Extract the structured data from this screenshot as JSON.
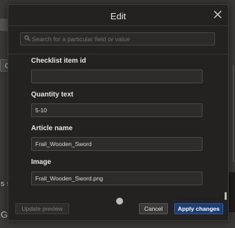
{
  "background": {
    "button_fragment": "C",
    "text_fragment_1": "s sl",
    "text_fragment_2": "Gr"
  },
  "modal": {
    "title": "Edit",
    "close_icon": "close-icon",
    "search": {
      "placeholder": "Search for a particular field or value",
      "icon": "search-icon"
    },
    "fields": [
      {
        "label": "Checklist item id",
        "value": ""
      },
      {
        "label": "Quantity text",
        "value": "5-10"
      },
      {
        "label": "Article name",
        "value": "Frail_Wooden_Sword"
      },
      {
        "label": "Image",
        "value": "Frail_Wooden_Sword.png"
      }
    ],
    "footer": {
      "update_preview": "Update preview",
      "cancel": "Cancel",
      "apply": "Apply changes"
    }
  },
  "colors": {
    "apply_button": "#1e3e73",
    "modal_background": "#232221"
  }
}
